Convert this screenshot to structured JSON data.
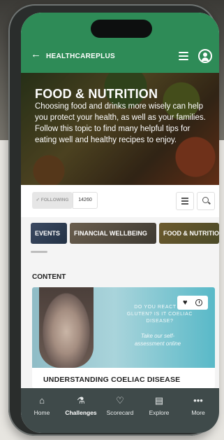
{
  "app": {
    "name": "HEALTHCAREPLUS"
  },
  "header": {
    "back_glyph": "←",
    "menu_icon": "hamburger-icon",
    "profile_icon": "user-icon"
  },
  "hero": {
    "title": "FOOD & NUTRITION",
    "description": "Choosing food and drinks more wisely can help you protect your health, as well as your families. Follow this topic to find many helpful tips for eating well and healthy recipes to enjoy."
  },
  "follow": {
    "button_label": "✓ FOLLOWING",
    "count": "14260"
  },
  "tabs": [
    {
      "label": "EVENTS"
    },
    {
      "label": "FINANCIAL WELLBEING"
    },
    {
      "label": "FOOD & NUTRITION"
    }
  ],
  "content": {
    "heading": "CONTENT",
    "card": {
      "image_text_1": "DO YOU REACT TO GLUTEN? IS IT COELIAC DISEASE?",
      "image_text_2": "Take our self-assessment online",
      "title": "UNDERSTANDING COELIAC DISEASE"
    }
  },
  "bottom_nav": [
    {
      "label": "Home",
      "icon": "home-icon",
      "glyph": "⌂",
      "active": false
    },
    {
      "label": "Challenges",
      "icon": "flask-icon",
      "glyph": "⚗",
      "active": true
    },
    {
      "label": "Scorecard",
      "icon": "heart-icon",
      "glyph": "♡",
      "active": false
    },
    {
      "label": "Explore",
      "icon": "stack-icon",
      "glyph": "▤",
      "active": false
    },
    {
      "label": "More",
      "icon": "more-icon",
      "glyph": "•••",
      "active": false
    }
  ],
  "colors": {
    "brand_green": "#2e8b57",
    "nav_bg": "#3f4a4a"
  }
}
